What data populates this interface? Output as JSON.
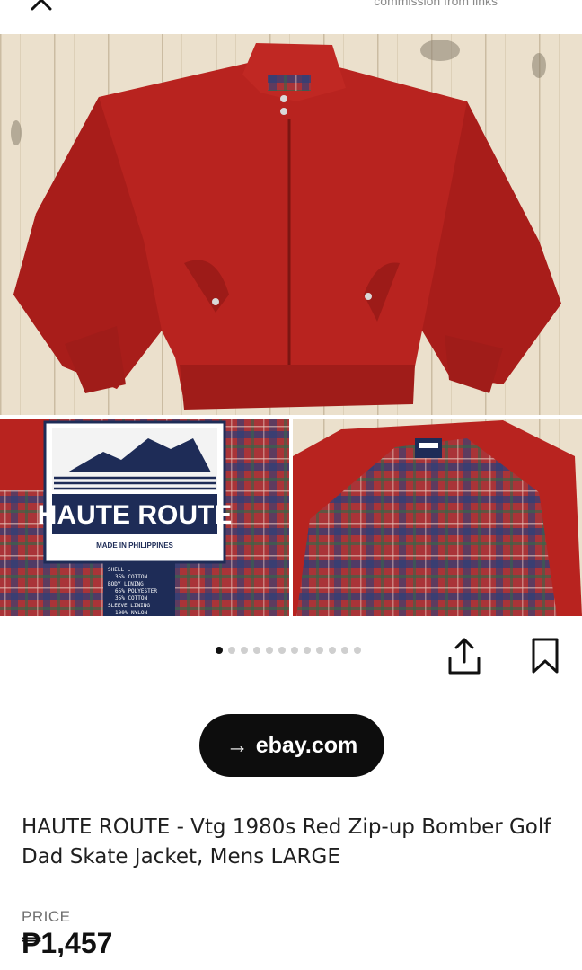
{
  "header": {
    "close_icon": "close-icon",
    "disclaimer": "commission from links"
  },
  "gallery": {
    "image_count": 12,
    "active_index": 0,
    "label_brand": "HAUTE ROUTE",
    "label_origin": "MADE IN PHILIPPINES",
    "label_size": "L",
    "label_fabric_lines": [
      "SHELL",
      "35% COTTON",
      "BODY LINING",
      "65% POLYESTER",
      "35% COTTON",
      "SLEEVE LINING",
      "100% NYLON"
    ]
  },
  "actions": {
    "share_icon": "share-icon",
    "save_icon": "bookmark-icon"
  },
  "visit": {
    "arrow": "→",
    "label": "ebay.com"
  },
  "product": {
    "title": "HAUTE ROUTE - Vtg 1980s Red Zip-up Bomber Golf Dad Skate Jacket, Mens LARGE"
  },
  "price": {
    "label": "PRICE",
    "value": "₱1,457"
  },
  "colors": {
    "jacket_red": "#b8231f",
    "plaid_red": "#b03a3c",
    "plaid_blue": "#2b3f7a",
    "label_navy": "#1e2c57",
    "wood": "#e9dcc6",
    "button_black": "#0d0d0d"
  }
}
